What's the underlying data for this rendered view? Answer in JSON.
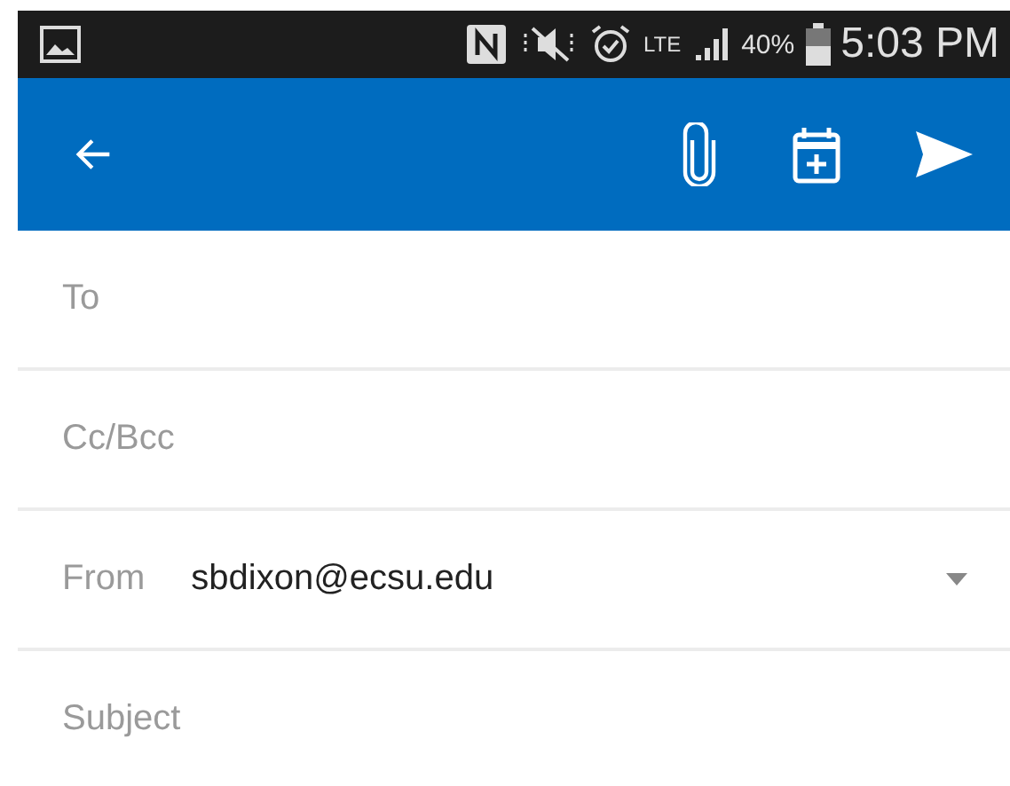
{
  "status_bar": {
    "network": "LTE",
    "battery": "40%",
    "time": "5:03 PM"
  },
  "fields": [
    {
      "kind": "input",
      "placeholder": "To"
    },
    {
      "kind": "input",
      "placeholder": "Cc/Bcc"
    },
    {
      "kind": "select",
      "label": "From",
      "value": "sbdixon@ecsu.edu"
    },
    {
      "kind": "input",
      "placeholder": "Subject"
    }
  ]
}
